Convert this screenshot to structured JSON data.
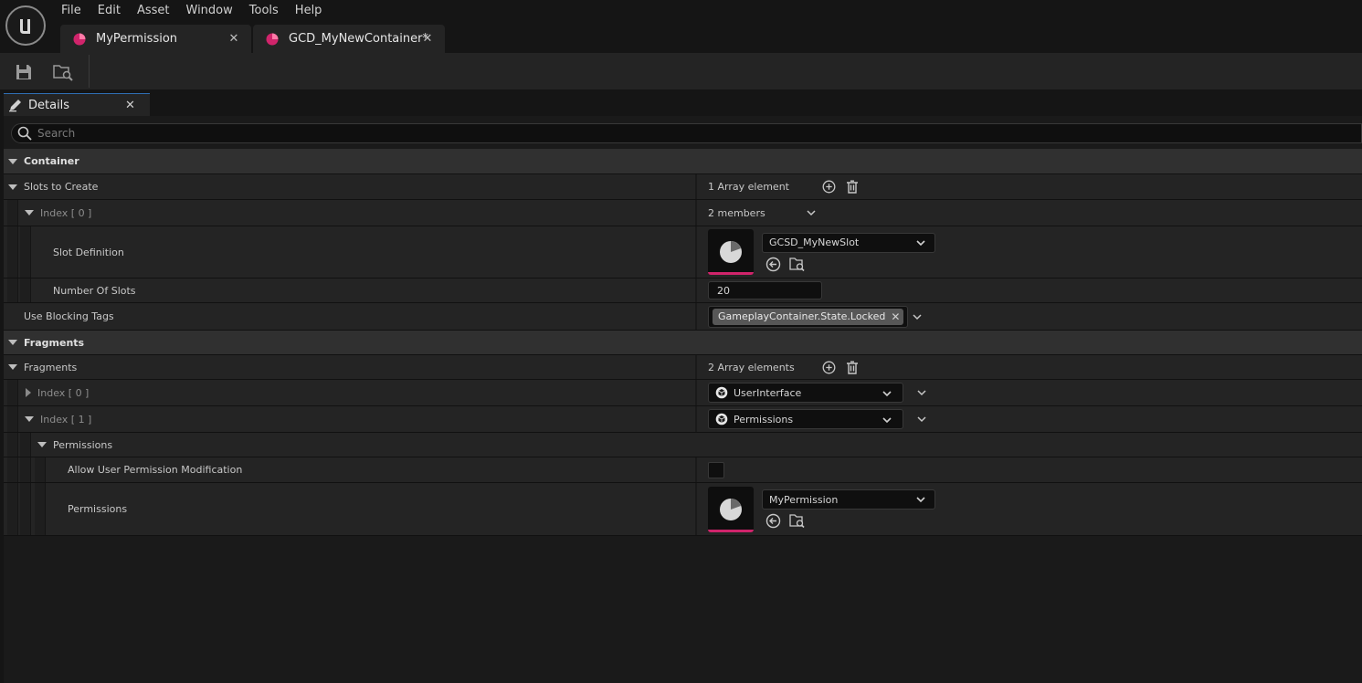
{
  "menu": [
    "File",
    "Edit",
    "Asset",
    "Window",
    "Tools",
    "Help"
  ],
  "tabs": [
    {
      "label": "MyPermission"
    },
    {
      "label": "GCD_MyNewContainer*"
    }
  ],
  "details_tab": {
    "label": "Details"
  },
  "search": {
    "placeholder": "Search"
  },
  "colors": {
    "accent_asset": "#d0246b",
    "panel": "#242424",
    "background": "#151515"
  },
  "rows": {
    "container_cat": "Container",
    "slots_to_create": {
      "label": "Slots to Create",
      "value": "1 Array element"
    },
    "index0": {
      "label": "Index [ 0 ]",
      "value": "2 members"
    },
    "slot_definition": {
      "label": "Slot Definition",
      "asset": "GCSD_MyNewSlot"
    },
    "number_of_slots": {
      "label": "Number Of Slots",
      "value": "20"
    },
    "use_blocking_tags": {
      "label": "Use Blocking Tags",
      "tag": "GameplayContainer.State.Locked"
    },
    "fragments_cat": "Fragments",
    "fragments": {
      "label": "Fragments",
      "value": "2 Array elements"
    },
    "frag_index0": {
      "label": "Index [ 0 ]",
      "value": "UserInterface"
    },
    "frag_index1": {
      "label": "Index [ 1 ]",
      "value": "Permissions"
    },
    "permissions_group": "Permissions",
    "allow_user_perm": {
      "label": "Allow User Permission Modification",
      "checked": false
    },
    "permissions": {
      "label": "Permissions",
      "asset": "MyPermission"
    }
  }
}
